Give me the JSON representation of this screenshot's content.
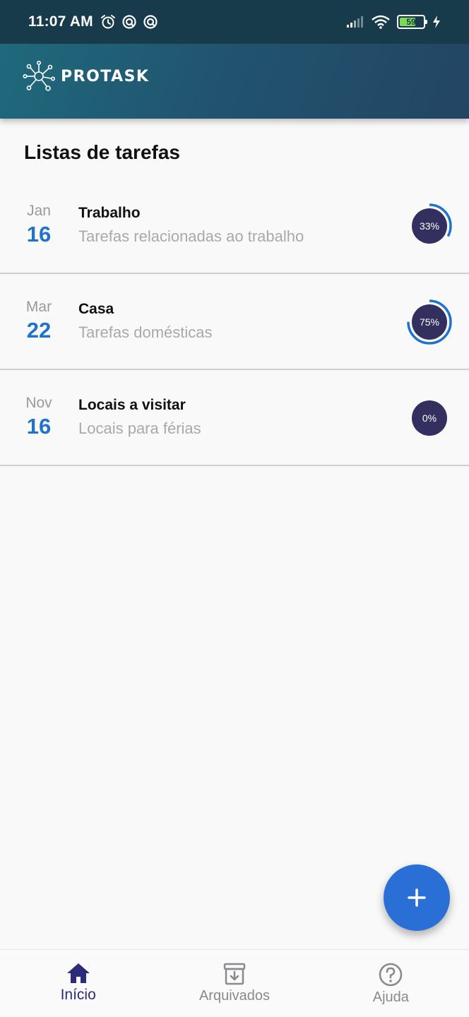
{
  "status_bar": {
    "time": "11:07 AM",
    "battery": "59",
    "left_icons": [
      "alarm-icon",
      "sync-icon",
      "sync-icon"
    ],
    "right_icons": [
      "signal-icon",
      "wifi-icon",
      "battery-icon",
      "charging-icon"
    ]
  },
  "app_bar": {
    "logo_icon": "network-logo-icon",
    "title": "PROTASK"
  },
  "page": {
    "title": "Listas de tarefas"
  },
  "task_lists": [
    {
      "month": "Jan",
      "day": "16",
      "title": "Trabalho",
      "description": "Tarefas relacionadas ao trabalho",
      "progress_label": "33%",
      "progress": 0.33
    },
    {
      "month": "Mar",
      "day": "22",
      "title": "Casa",
      "description": "Tarefas domésticas",
      "progress_label": "75%",
      "progress": 0.75
    },
    {
      "month": "Nov",
      "day": "16",
      "title": "Locais a visitar",
      "description": "Locais para férias",
      "progress_label": "0%",
      "progress": 0
    }
  ],
  "fab": {
    "icon": "plus-icon"
  },
  "bottom_nav": [
    {
      "label": "Início",
      "icon": "home-icon",
      "active": true
    },
    {
      "label": "Arquivados",
      "icon": "archive-icon",
      "active": false
    },
    {
      "label": "Ajuda",
      "icon": "help-icon",
      "active": false
    }
  ],
  "colors": {
    "accent": "#1f73c9",
    "fab": "#2a6fd6",
    "progress_circle": "#33305f",
    "progress_ring": "#1f73c9",
    "nav_active": "#2c2c79"
  }
}
